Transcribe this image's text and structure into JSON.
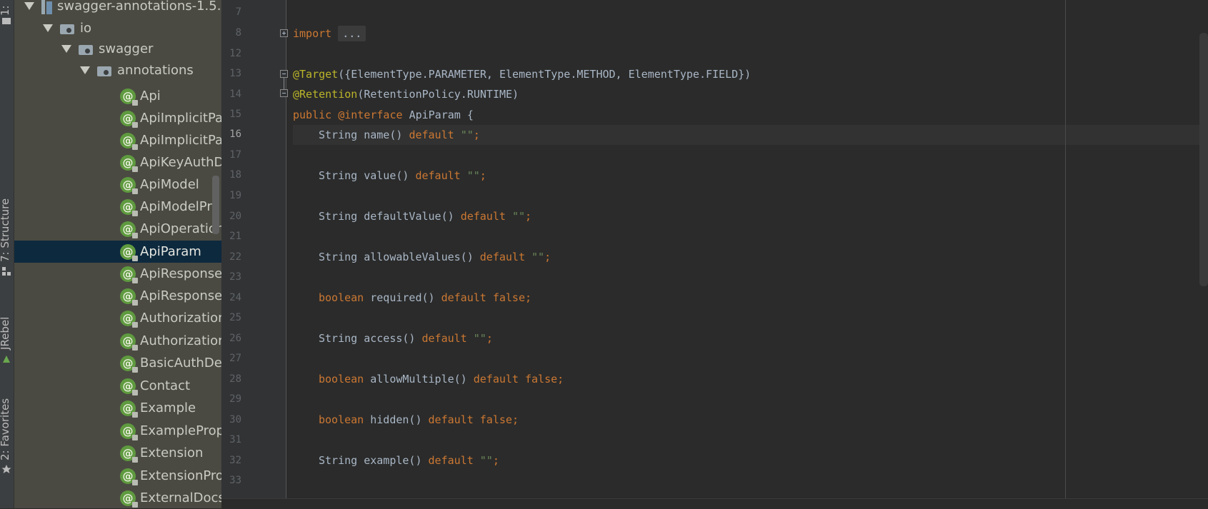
{
  "tool_strip": {
    "top_label": "1:",
    "structure_label": "7: Structure",
    "jrebel_label": "JRebel",
    "favorites_label": "2: Favorites"
  },
  "tree": {
    "library": "swagger-annotations-1.5.",
    "packages": [
      "io",
      "swagger",
      "annotations"
    ],
    "items": [
      "Api",
      "ApiImplicitPa",
      "ApiImplicitPa",
      "ApiKeyAuthD",
      "ApiModel",
      "ApiModelPro",
      "ApiOperation",
      "ApiParam",
      "ApiResponse",
      "ApiResponses",
      "Authorization",
      "Authorization",
      "BasicAuthDef",
      "Contact",
      "Example",
      "ExampleProp",
      "Extension",
      "ExtensionProp",
      "ExternalDocs"
    ],
    "selected": "ApiParam",
    "annotation_symbol": "@"
  },
  "editor": {
    "line_numbers": [
      "7",
      "8",
      "12",
      "13",
      "14",
      "15",
      "16",
      "17",
      "18",
      "19",
      "20",
      "21",
      "22",
      "23",
      "24",
      "25",
      "26",
      "27",
      "28",
      "29",
      "30",
      "31",
      "32",
      "33"
    ],
    "current_line": "16",
    "code": {
      "import_kw": "import",
      "import_folded": "...",
      "target_ann": "@Target",
      "target_args": "({ElementType.PARAMETER, ElementType.METHOD, ElementType.FIELD})",
      "retention_ann": "@Retention",
      "retention_args": "(RetentionPolicy.RUNTIME)",
      "public_kw": "public",
      "interface_kw": "@interface",
      "interface_name": "ApiParam {",
      "default_kw": "default",
      "empty_str": "\"\"",
      "false_kw": "false",
      "boolean_kw": "boolean",
      "members": {
        "name": "String name()",
        "value": "String value()",
        "defaultValue": "String defaultValue()",
        "allowableValues": "String allowableValues()",
        "required": "required()",
        "access": "String access()",
        "allowMultiple": "allowMultiple()",
        "hidden": "hidden()",
        "example": "String example()"
      }
    }
  }
}
